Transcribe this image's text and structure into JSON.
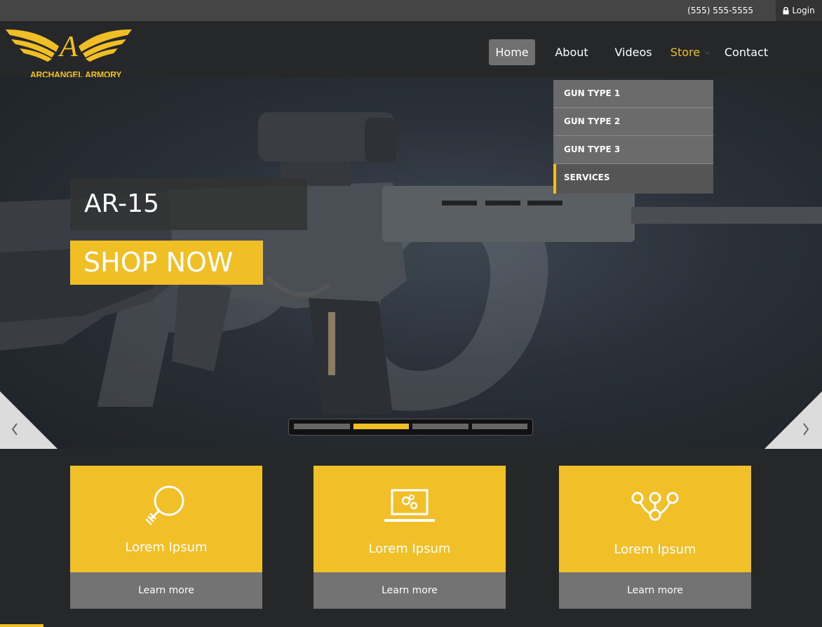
{
  "topbar": {
    "phone": "(555) 555-5555",
    "login_label": "Login"
  },
  "brand": {
    "name": "ARCHANGEL ARMORY",
    "logo_letter": "A",
    "accent_color": "#f0be25"
  },
  "nav": {
    "items": [
      {
        "label": "Home",
        "active": true
      },
      {
        "label": "About"
      },
      {
        "label": "Videos"
      },
      {
        "label": "Store",
        "has_dropdown": true,
        "highlighted": true
      },
      {
        "label": "Contact"
      }
    ]
  },
  "store_dropdown": {
    "items": [
      {
        "label": "GUN TYPE 1"
      },
      {
        "label": "GUN TYPE 2"
      },
      {
        "label": "GUN TYPE 3"
      },
      {
        "label": "SERVICES",
        "selected": true
      }
    ]
  },
  "hero": {
    "title": "AR-15",
    "cta_label": "SHOP NOW",
    "active_slide": 2,
    "slide_count": 4
  },
  "cards": [
    {
      "icon": "lightbulb-icon",
      "label": "Lorem Ipsum",
      "button": "Learn more"
    },
    {
      "icon": "laptop-gears-icon",
      "label": "Lorem Ipsum",
      "button": "Learn more"
    },
    {
      "icon": "network-nodes-icon",
      "label": "Lorem Ipsum",
      "button": "Learn more"
    }
  ]
}
